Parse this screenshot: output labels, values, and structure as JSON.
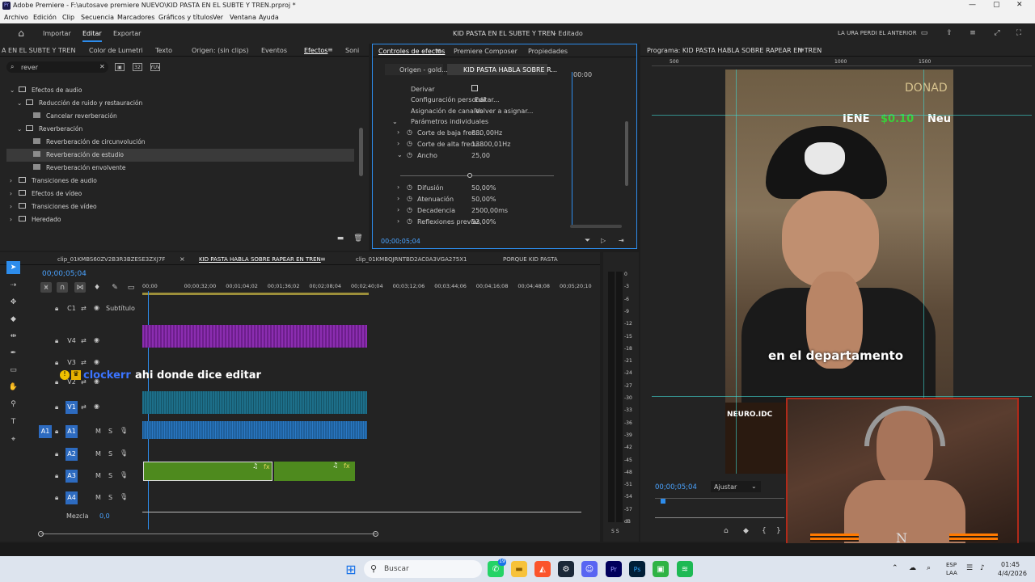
{
  "window": {
    "title": "Adobe Premiere - F:\\autosave premiere NUEVO\\KID PASTA EN EL SUBTE Y TREN.prproj *"
  },
  "menu": [
    "Archivo",
    "Edición",
    "Clip",
    "Secuencia",
    "Marcadores",
    "Gráficos y títulos",
    "Ver",
    "Ventana",
    "Ayuda"
  ],
  "workspace": {
    "import": "Importar",
    "edit": "Editar",
    "export": "Exportar",
    "project_title": "KID PASTA EN EL SUBTE Y TREN",
    "edited": "- Editado",
    "right_label": "LA URA PERDI EL ANTERIOR"
  },
  "effects_panel": {
    "tabs": [
      "A EN EL SUBTE Y TREN",
      "Color de Lumetri",
      "Texto",
      "Origen: (sin clips)",
      "Eventos",
      "Efectos",
      "Soni"
    ],
    "search_value": "rever",
    "tree": [
      {
        "label": "Efectos de audio",
        "indent": 1,
        "open": true
      },
      {
        "label": "Reducción de ruido y restauración",
        "indent": 2,
        "open": true
      },
      {
        "label": "Cancelar reverberación",
        "indent": 3,
        "leaf": true
      },
      {
        "label": "Reverberación",
        "indent": 2,
        "open": true
      },
      {
        "label": "Reverberación de circunvolución",
        "indent": 3,
        "leaf": true
      },
      {
        "label": "Reverberación de estudio",
        "indent": 3,
        "leaf": true,
        "selected": true
      },
      {
        "label": "Reverberación envolvente",
        "indent": 3,
        "leaf": true
      },
      {
        "label": "Transiciones de audio",
        "indent": 1
      },
      {
        "label": "Efectos de vídeo",
        "indent": 1
      },
      {
        "label": "Transiciones de vídeo",
        "indent": 1
      },
      {
        "label": "Heredado",
        "indent": 1
      }
    ]
  },
  "effect_controls": {
    "tabs": [
      "Controles de efectos",
      "Premiere Composer",
      "Propiedades"
    ],
    "source": "Origen - gold...",
    "sequence": "KID PASTA HABLA SOBRE R...",
    "timecode_head": "00:00",
    "bypass": "Derivar",
    "custom_setup": "Configuración personal",
    "edit_btn": "Editar...",
    "channel_map": "Asignación de canales",
    "reassign_btn": "Volver a asignar...",
    "params_header": "Parámetros individuales",
    "params": [
      {
        "name": "Corte de baja frec...",
        "value": "880,00Hz"
      },
      {
        "name": "Corte de alta frecu...",
        "value": "13800,01Hz"
      },
      {
        "name": "Ancho",
        "value": "25,00"
      },
      {
        "name": "Difusión",
        "value": "50,00%"
      },
      {
        "name": "Atenuación",
        "value": "50,00%"
      },
      {
        "name": "Decadencia",
        "value": "2500,00ms"
      },
      {
        "name": "Reflexiones previas",
        "value": "52,00%"
      }
    ],
    "slider_level": 0.45,
    "timecode": "00;00;05;04"
  },
  "program": {
    "title": "Programa: KID PASTA HABLA SOBRE RAPEAR EN TREN",
    "ruler": [
      "500",
      "1000",
      "1500"
    ],
    "overlay_top": "DONAD",
    "overlay_ticker": "IENE",
    "overlay_money": "$0.10",
    "overlay_neu": "Neu",
    "overlay_neuro": "NEURO.IDC",
    "caption": "en el departamento",
    "timecode": "00;00;05;04",
    "fit": "Ajustar"
  },
  "timeline": {
    "tabs": [
      "clip_01KMBS60ZV2B3R3BZESE3ZXJ7F",
      "KID PASTA HABLA SOBRE RAPEAR EN TREN",
      "clip_01KMBQJRNTBD2AC0A3VGA275X1",
      "PORQUE KID PASTA"
    ],
    "timecode": "00;00;05;04",
    "ruler": [
      "00;00",
      "00;00;32;00",
      "00;01;04;02",
      "00;01;36;02",
      "00;02;08;04",
      "00;02;40;04",
      "00;03;12;06",
      "00;03;44;06",
      "00;04;16;08",
      "00;04;48;08",
      "00;05;20;10"
    ],
    "tracks": [
      {
        "name": "C1",
        "label": "Subtítulo"
      },
      {
        "name": "V4"
      },
      {
        "name": "V3"
      },
      {
        "name": "V2"
      },
      {
        "name": "V1"
      },
      {
        "name": "A1"
      },
      {
        "name": "A2"
      },
      {
        "name": "A3"
      },
      {
        "name": "A4"
      }
    ],
    "mix_label": "Mezcla",
    "mix_value": "0,0",
    "chat_user": "clockerr",
    "chat_msg": "ahi donde dice editar"
  },
  "meter": {
    "ticks": [
      "0",
      "-3",
      "-6",
      "-9",
      "-12",
      "-15",
      "-18",
      "-21",
      "-24",
      "-27",
      "-30",
      "-33",
      "-36",
      "-39",
      "-42",
      "-45",
      "-48",
      "-51",
      "-54",
      "-57",
      "dB"
    ],
    "bottom": "S S"
  },
  "taskbar": {
    "search": "Buscar",
    "lang": "ESP",
    "lang2": "LAA",
    "time": "01:45",
    "date": "4/4/2026",
    "badge": "19"
  },
  "colors": {
    "accent": "#2d8ceb",
    "v4": "#8b2db0",
    "v1": "#1d6f8a",
    "a1": "#1f5f9a",
    "a3": "#4e8a1e"
  }
}
